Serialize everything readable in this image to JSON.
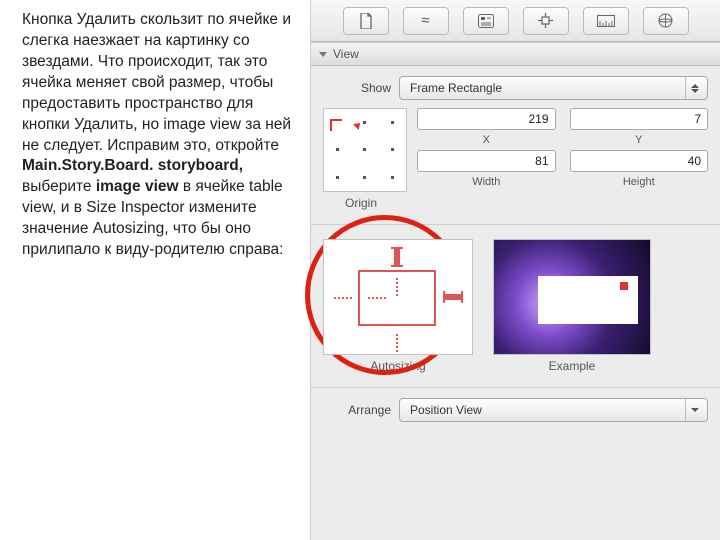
{
  "leftText": "Кнопка Удалить скользит по ячейке и слегка наезжает на картинку со звездами. Что происходит, так это ячейка меняет свой размер, чтобы предоставить пространство для кнопки Удалить, но image view за ней не следует. Исправим это, откройте ",
  "leftBold1": "Main.Story.Board. storyboard,",
  "leftMid": " выберите ",
  "leftBold2": "image view",
  "leftTail": " в ячейке table view, и в Size Inspector измените значение Autosizing, что бы оно прилипало к виду-родителю справа:",
  "section": {
    "view": "View"
  },
  "show": {
    "label": "Show",
    "value": "Frame Rectangle"
  },
  "frame": {
    "x": "219",
    "y": "7",
    "xLabel": "X",
    "yLabel": "Y",
    "w": "81",
    "h": "40",
    "wLabel": "Width",
    "hLabel": "Height"
  },
  "originLabel": "Origin",
  "autosizing": {
    "label": "Autosizing",
    "exampleLabel": "Example"
  },
  "arrange": {
    "label": "Arrange",
    "value": "Position View"
  }
}
